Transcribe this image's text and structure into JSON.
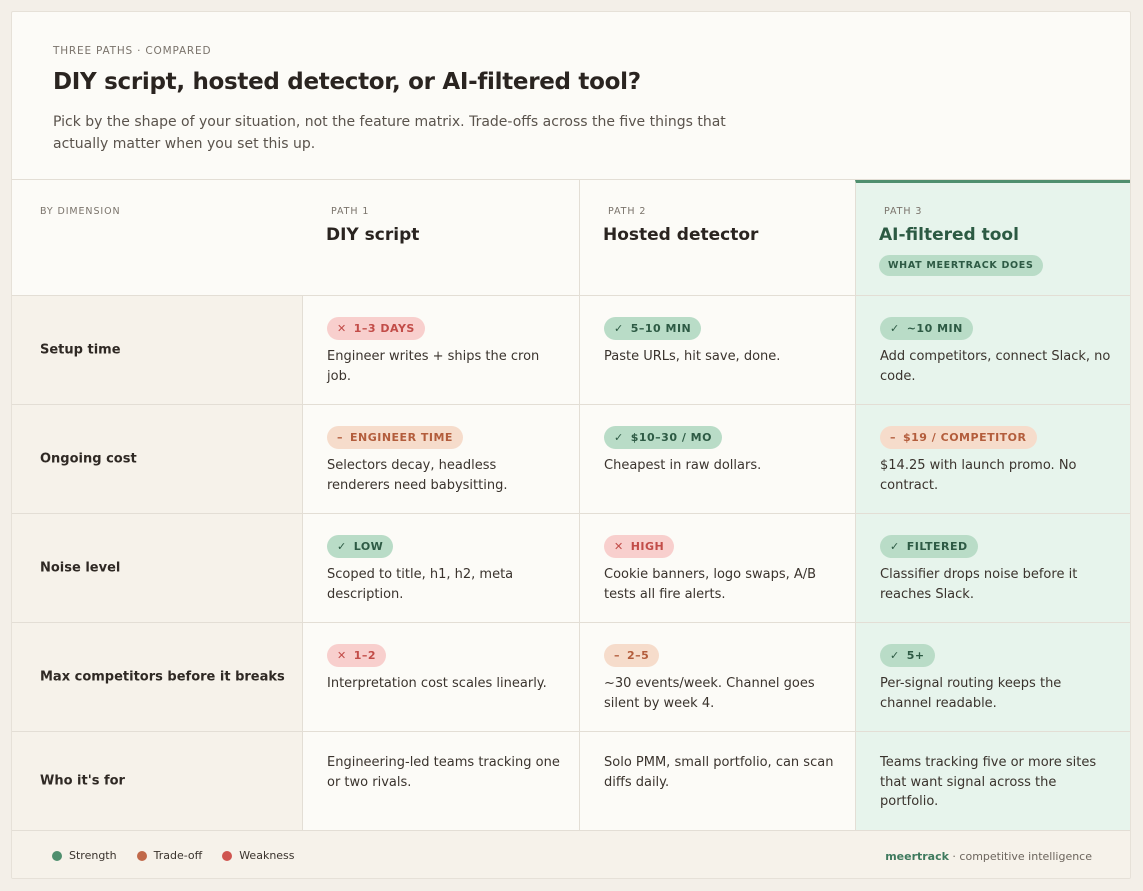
{
  "header": {
    "eyebrow": "THREE PATHS · COMPARED",
    "title": "DIY script, hosted detector, or AI-filtered tool?",
    "subtitle": "Pick by the shape of your situation, not the feature matrix. Trade-offs across the five things that actually matter when you set this up."
  },
  "columns": {
    "dimension_label": "BY DIMENSION",
    "paths": [
      {
        "label": "PATH 1",
        "name": "DIY script"
      },
      {
        "label": "PATH 2",
        "name": "Hosted detector"
      },
      {
        "label": "PATH 3",
        "name": "AI-filtered tool",
        "badge": "WHAT MEERTRACK DOES"
      }
    ]
  },
  "rows": [
    {
      "dimension": "Setup time",
      "cells": [
        {
          "status": "bad",
          "icon": "x-icon",
          "badge": "1–3 DAYS",
          "text": "Engineer writes + ships the cron job."
        },
        {
          "status": "good",
          "icon": "check-icon",
          "badge": "5–10 MIN",
          "text": "Paste URLs, hit save, done."
        },
        {
          "status": "good",
          "icon": "check-icon",
          "badge": "~10 MIN",
          "text": "Add competitors, connect Slack, no code."
        }
      ]
    },
    {
      "dimension": "Ongoing cost",
      "cells": [
        {
          "status": "mid",
          "icon": "dash-icon",
          "badge": "ENGINEER TIME",
          "text": "Selectors decay, headless renderers need babysitting."
        },
        {
          "status": "good",
          "icon": "check-icon",
          "badge": "$10–30 / MO",
          "text": "Cheapest in raw dollars."
        },
        {
          "status": "mid",
          "icon": "dash-icon",
          "badge": "$19 / COMPETITOR",
          "text": "$14.25 with launch promo. No contract."
        }
      ]
    },
    {
      "dimension": "Noise level",
      "cells": [
        {
          "status": "good",
          "icon": "check-icon",
          "badge": "LOW",
          "text": "Scoped to title, h1, h2, meta description."
        },
        {
          "status": "bad",
          "icon": "x-icon",
          "badge": "HIGH",
          "text": "Cookie banners, logo swaps, A/B tests all fire alerts."
        },
        {
          "status": "good",
          "icon": "check-icon",
          "badge": "FILTERED",
          "text": "Classifier drops noise before it reaches Slack."
        }
      ]
    },
    {
      "dimension": "Max competitors before it breaks",
      "cells": [
        {
          "status": "bad",
          "icon": "x-icon",
          "badge": "1–2",
          "text": "Interpretation cost scales linearly."
        },
        {
          "status": "mid",
          "icon": "dash-icon",
          "badge": "2–5",
          "text": "~30 events/week. Channel goes silent by week 4."
        },
        {
          "status": "good",
          "icon": "check-icon",
          "badge": "5+",
          "text": "Per-signal routing keeps the channel readable."
        }
      ]
    },
    {
      "dimension": "Who it's for",
      "cells": [
        {
          "text": "Engineering-led teams tracking one or two rivals."
        },
        {
          "text": "Solo PMM, small portfolio, can scan diffs daily."
        },
        {
          "text": "Teams tracking five or more sites that want signal across the portfolio."
        }
      ]
    }
  ],
  "legend": [
    {
      "label": "Strength",
      "color": "#4f8f6e"
    },
    {
      "label": "Trade-off",
      "color": "#c0694a"
    },
    {
      "label": "Weakness",
      "color": "#cf5550"
    }
  ],
  "brand": {
    "name": "meertrack",
    "tagline": " · competitive intelligence"
  },
  "icons": {
    "check-icon": "✓",
    "x-icon": "✕",
    "dash-icon": "–"
  }
}
